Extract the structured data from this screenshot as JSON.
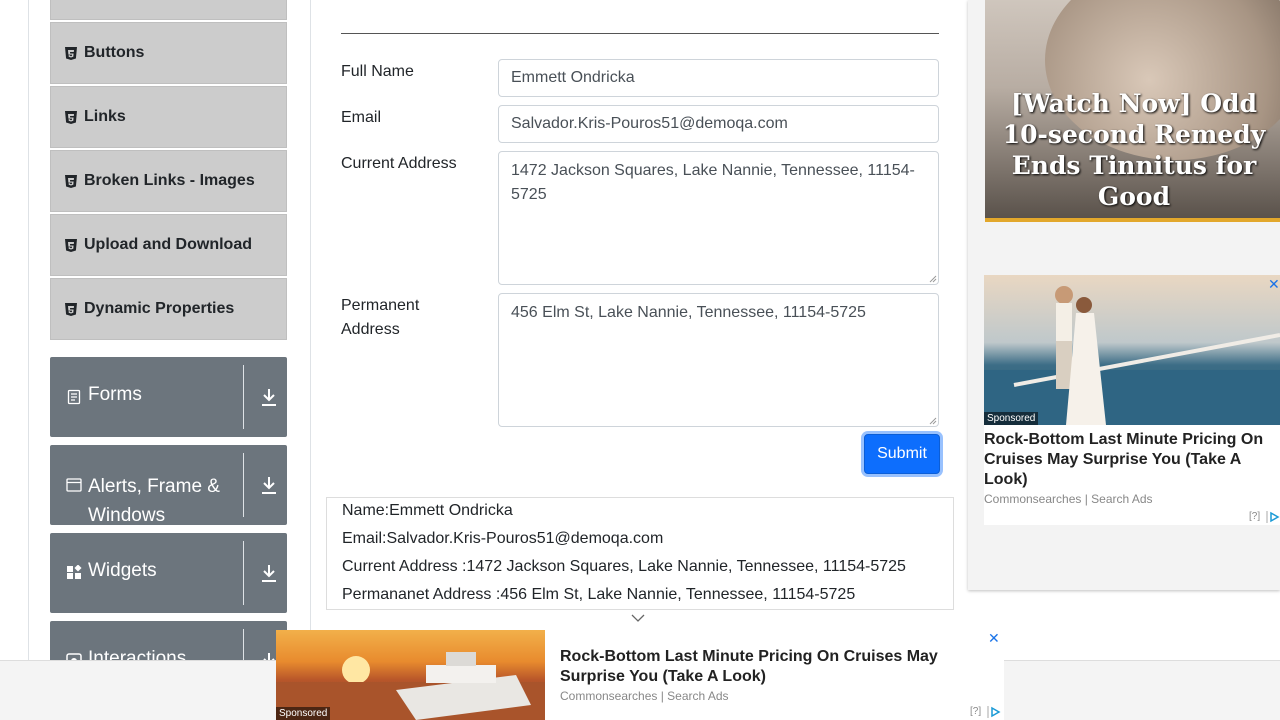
{
  "sidebar": {
    "subitems": [
      {
        "label": "Buttons"
      },
      {
        "label": "Links"
      },
      {
        "label": "Broken Links - Images"
      },
      {
        "label": "Upload and Download"
      },
      {
        "label": "Dynamic Properties"
      }
    ],
    "groups": [
      {
        "label": "Forms",
        "icon": "document-icon"
      },
      {
        "label": "Alerts, Frame &",
        "label2": "Windows",
        "icon": "window-icon"
      },
      {
        "label": "Widgets",
        "icon": "widgets-icon"
      },
      {
        "label": "Interactions",
        "icon": "interactions-icon"
      }
    ]
  },
  "form": {
    "full_name_label": "Full Name",
    "full_name_value": "Emmett Ondricka",
    "email_label": "Email",
    "email_value": "Salvador.Kris-Pouros51@demoqa.com",
    "current_address_label": "Current Address",
    "current_address_value": "1472 Jackson Squares, Lake Nannie, Tennessee, 11154-5725",
    "permanent_address_label_1": "Permanent",
    "permanent_address_label_2": "Address",
    "permanent_address_value": "456 Elm St, Lake Nannie, Tennessee, 11154-5725",
    "submit_label": "Submit"
  },
  "output": {
    "name": "Name:Emmett Ondricka",
    "email": "Email:Salvador.Kris-Pouros51@demoqa.com",
    "current_address": "Current Address :1472 Jackson Squares, Lake Nannie, Tennessee, 11154-5725",
    "permanent_address": "Permananet Address :456 Elm St, Lake Nannie, Tennessee, 11154-5725"
  },
  "ads": {
    "hero_headline": "[Watch Now] Odd 10-second Remedy Ends Tinnitus for Good",
    "card_sponsored": "Sponsored",
    "card_title": "Rock-Bottom Last Minute Pricing On Cruises May Surprise You (Take A Look)",
    "card_source": "Commonsearches | Search Ads",
    "adchoice_label": "[?]",
    "close_glyph": "✕",
    "sticky_sponsored": "Sponsored",
    "sticky_title": "Rock-Bottom Last Minute Pricing On Cruises May Surprise You (Take A Look)",
    "sticky_source": "Commonsearches | Search Ads"
  },
  "colors": {
    "submit_blue": "#0d6efd",
    "group_gray": "#6c757d",
    "submenu_gray": "#cccccc"
  }
}
